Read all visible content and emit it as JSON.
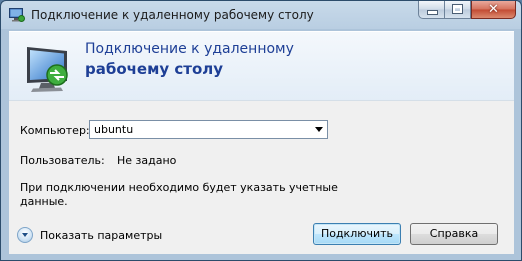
{
  "window": {
    "title": "Подключение к удаленному рабочему столу"
  },
  "banner": {
    "line1": "Подключение к удаленному",
    "line2": "рабочему столу"
  },
  "form": {
    "computer_label": "Компьютер:",
    "computer_value": "ubuntu",
    "user_label": "Пользователь:",
    "user_value": "Не задано",
    "info_line1": "При подключении необходимо будет указать учетные",
    "info_line2": "данные."
  },
  "footer": {
    "options_label": "Показать параметры",
    "connect_label": "Подключить",
    "help_label": "Справка"
  },
  "icons": {
    "title": "remote-desktop-icon",
    "banner": "remote-desktop-monitor-icon",
    "options": "expand-options-icon"
  },
  "colors": {
    "banner_text": "#1e3f96",
    "close_button": "#c24a32",
    "default_button": "#3c7fb1"
  }
}
